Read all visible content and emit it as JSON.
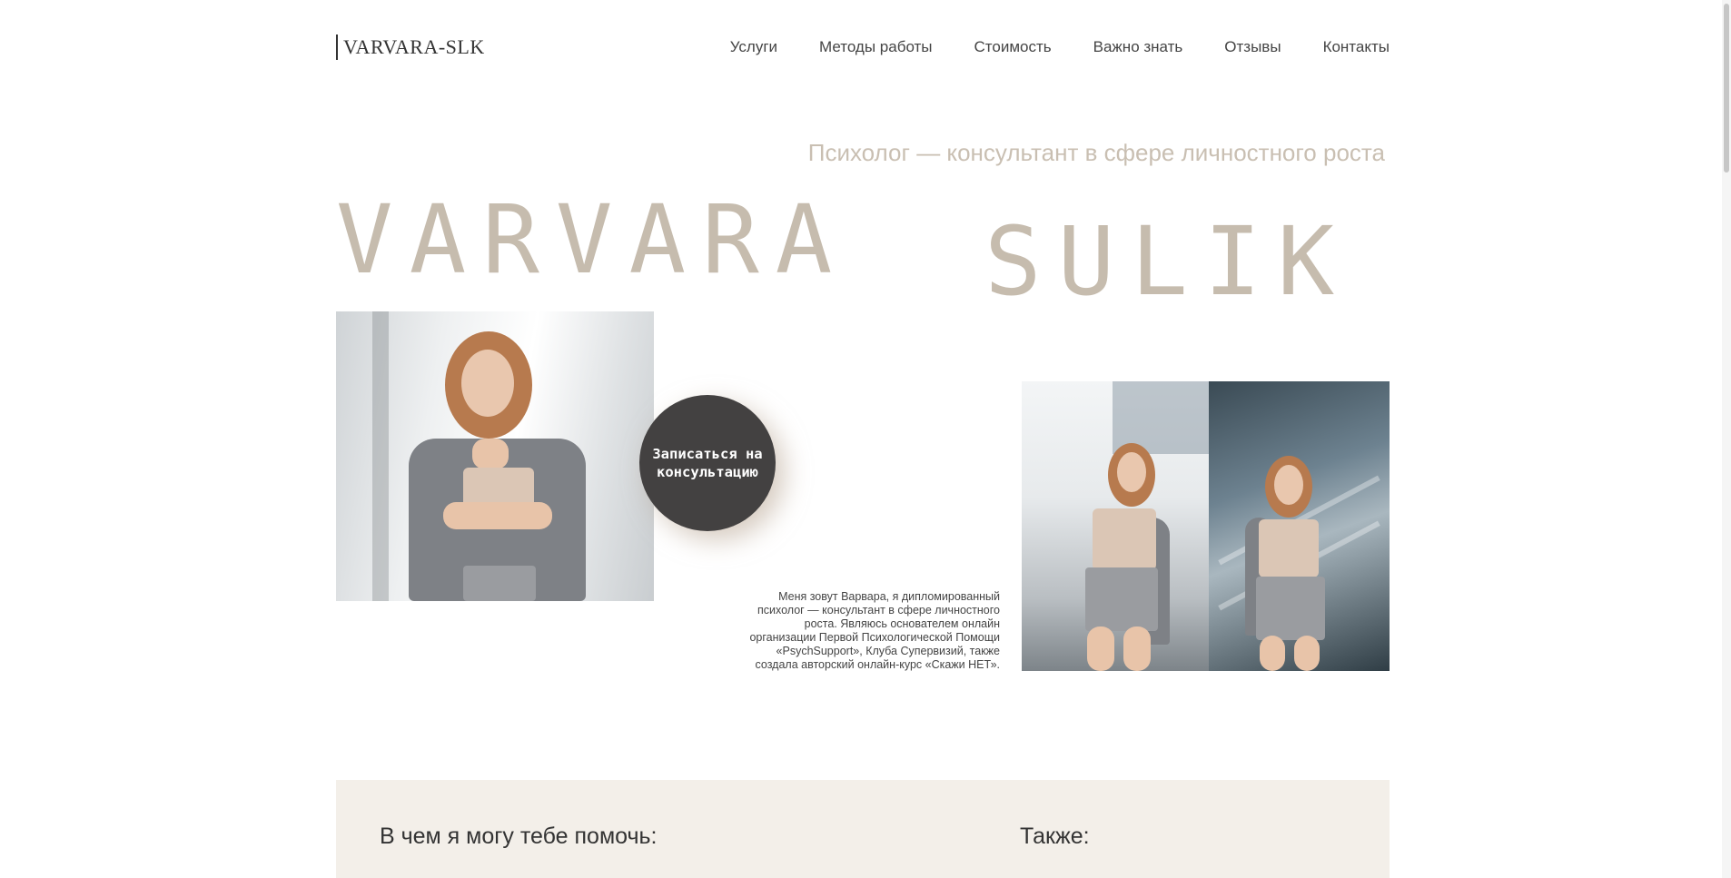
{
  "header": {
    "logo": "VARVARA-SLK",
    "nav": [
      "Услуги",
      "Методы работы",
      "Стоимость",
      "Важно знать",
      "Отзывы",
      "Контакты"
    ]
  },
  "hero": {
    "subtitle": "Психолог — консультант в сфере личностного роста",
    "first_name": "VARVARA",
    "last_name": "SULIK",
    "cta": "Записаться на консультацию",
    "bio_lines": [
      "Меня зовут Варвара, я дипломированный",
      "психолог — консультант в сфере личностного",
      "роста.  Являюсь основателем онлайн",
      "организации Первой Психологической Помощи",
      "«PsychSupport», Клуба Супервизий, также",
      "создала авторский онлайн-курс «Скажи НЕТ»."
    ]
  },
  "help": {
    "title": "В чем я могу тебе помочь:",
    "also": "Также:"
  },
  "colors": {
    "accent_beige": "#c6bcae",
    "cta_dark": "#434141",
    "section_bg": "#f3efe9"
  }
}
